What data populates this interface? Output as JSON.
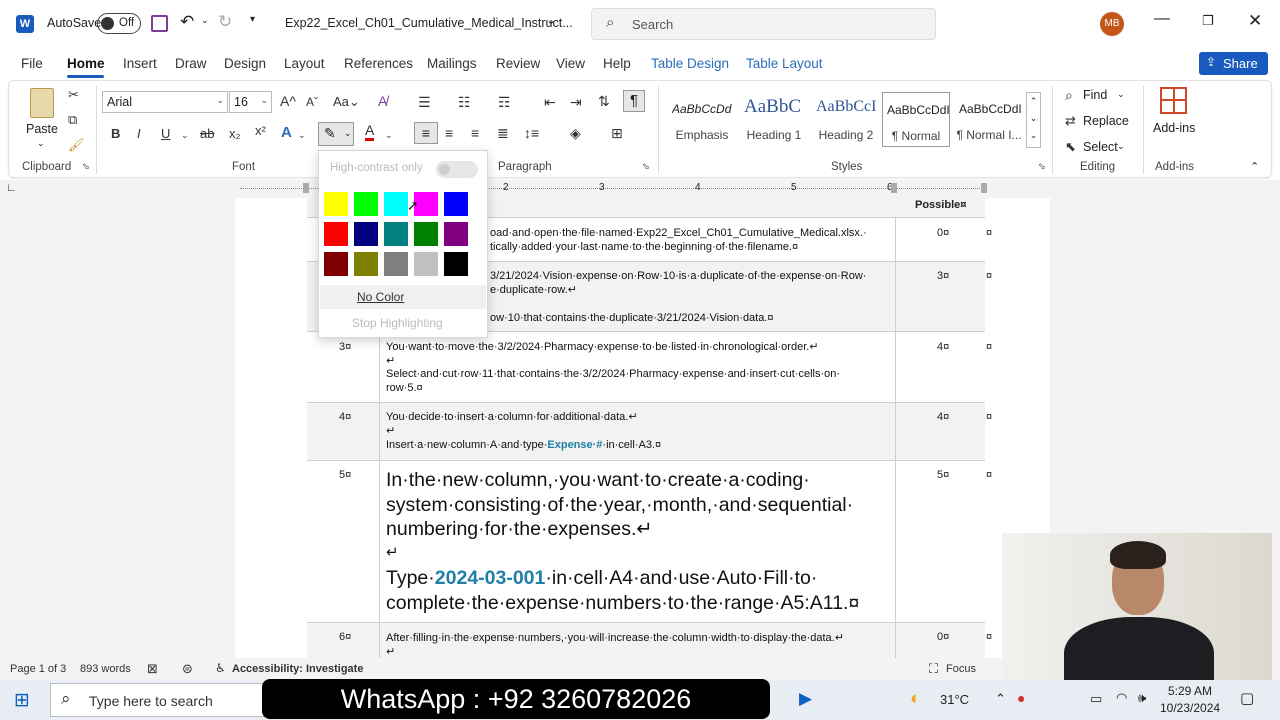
{
  "titlebar": {
    "autosave_label": "AutoSave",
    "autosave_state": "Off",
    "filename": "Exp22_Excel_Ch01_Cumulative_Medical_Instruct...",
    "search_placeholder": "Search",
    "user_initials": "MB"
  },
  "tabs": [
    "File",
    "Home",
    "Insert",
    "Draw",
    "Design",
    "Layout",
    "References",
    "Mailings",
    "Review",
    "View",
    "Help",
    "Table Design",
    "Table Layout"
  ],
  "share_label": "Share",
  "ribbon": {
    "clipboard": {
      "paste": "Paste",
      "label": "Clipboard"
    },
    "font": {
      "name": "Arial",
      "size": "16",
      "label": "Font"
    },
    "paragraph": {
      "label": "Paragraph"
    },
    "styles": {
      "label": "Styles",
      "items": [
        {
          "preview": "AaBbCcDd",
          "name": "Emphasis"
        },
        {
          "preview": "AaBbC",
          "name": "Heading 1"
        },
        {
          "preview": "AaBbCcI",
          "name": "Heading 2"
        },
        {
          "preview": "AaBbCcDdI",
          "name": "¶ Normal"
        },
        {
          "preview": "AaBbCcDdI",
          "name": "¶ Normal I..."
        }
      ]
    },
    "editing": {
      "label": "Editing",
      "find": "Find",
      "replace": "Replace",
      "select": "Select"
    },
    "addins": {
      "label": "Add-ins",
      "button": "Add-ins"
    }
  },
  "highlight_menu": {
    "high_contrast": "High-contrast only",
    "no_color": "No Color",
    "stop": "Stop Highlighting",
    "colors": [
      "#ffff00",
      "#00ff00",
      "#00ffff",
      "#ff00ff",
      "#0000ff",
      "#ff0000",
      "#000080",
      "#008080",
      "#008000",
      "#800080",
      "#800000",
      "#808000",
      "#808080",
      "#c0c0c0",
      "#000000"
    ]
  },
  "table": {
    "header_points": "Possible¤",
    "rows": [
      {
        "step": "",
        "points": "0¤",
        "lines": [
          "oad·and·open·the·file·named·Exp22_Excel_Ch01_Cumulative_Medical.xlsx.·",
          "tically·added·your·last·name·to·the·beginning·of·the·filename.¤"
        ]
      },
      {
        "step": "",
        "points": "3¤",
        "lines": [
          "3/21/2024·Vision·expense·on·Row·10·is·a·duplicate·of·the·expense·on·Row·",
          "e·duplicate·row.↵",
          "ow·10·that·contains·the·duplicate·3/21/2024·Vision·data.¤"
        ]
      },
      {
        "step": "3¤",
        "points": "4¤",
        "lines": [
          "You·want·to·move·the·3/2/2024·Pharmacy·expense·to·be·listed·in·chronological·order.↵",
          "↵",
          "Select·and·cut·row·11·that·contains·the·3/2/2024·Pharmacy·expense·and·insert·cut·cells·on·",
          "row·5.¤"
        ]
      },
      {
        "step": "4¤",
        "points": "4¤",
        "lines": [
          "You·decide·to·insert·a·column·for·additional·data.↵",
          "↵",
          "Insert·a·new·column·A·and·type·",
          "Expense·#",
          "·in·cell·A3.¤"
        ]
      },
      {
        "step": "5¤",
        "points": "5¤",
        "lines": [
          "In·the·new·column,·you·want·to·create·a·coding·",
          "system·consisting·of·the·year,·month,·and·sequential·",
          "numbering·for·the·expenses.↵",
          "↵",
          "Type·",
          "2024-03-001",
          "·in·cell·A4·and·use·Auto·Fill·to·",
          "complete·the·expense·numbers·to·the·range·A5:A11.¤"
        ]
      },
      {
        "step": "6¤",
        "points": "0¤",
        "lines": [
          "After·filling·in·the·expense·numbers,·you·will·increase·the·column·width·to·display·the·data.↵",
          "↵"
        ]
      }
    ],
    "end_mark": "¤"
  },
  "statusbar": {
    "page": "Page 1 of 3",
    "words": "893 words",
    "accessibility": "Accessibility: Investigate",
    "focus": "Focus"
  },
  "taskbar": {
    "search": "Type here to search",
    "weather": "31°C",
    "time": "5:29 AM",
    "date": "10/23/2024"
  },
  "overlay": {
    "whatsapp": "WhatsApp : +92 3260782026"
  }
}
